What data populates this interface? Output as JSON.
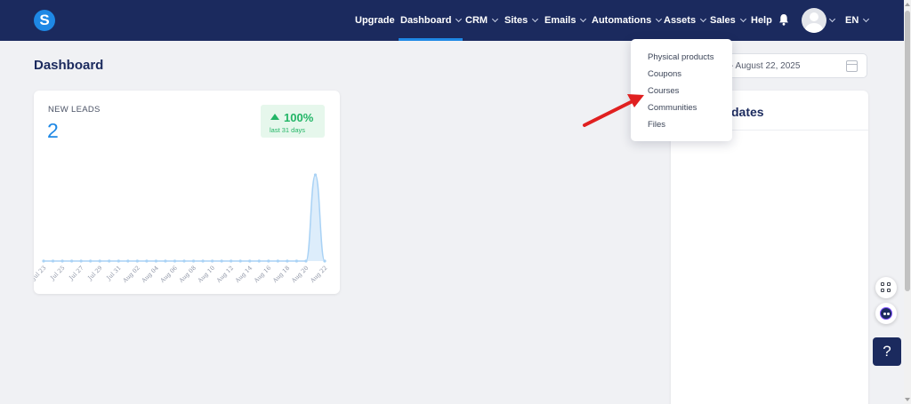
{
  "nav": {
    "logo": "S",
    "items": [
      {
        "label": "Upgrade"
      },
      {
        "label": "Dashboard"
      },
      {
        "label": "CRM"
      },
      {
        "label": "Sites"
      },
      {
        "label": "Emails"
      },
      {
        "label": "Automations"
      },
      {
        "label": "Assets"
      },
      {
        "label": "Sales"
      },
      {
        "label": "Help"
      }
    ],
    "language": "EN"
  },
  "page": {
    "title": "Dashboard",
    "date_range": "- August 22, 2025"
  },
  "leads_card": {
    "label": "NEW LEADS",
    "value": "2",
    "change": "100%",
    "change_period": "last 31 days"
  },
  "updates_panel": {
    "title": "dates"
  },
  "assets_dropdown": {
    "items": [
      {
        "label": "Physical products"
      },
      {
        "label": "Coupons"
      },
      {
        "label": "Courses"
      },
      {
        "label": "Communities"
      },
      {
        "label": "Files"
      }
    ]
  },
  "help_button": {
    "label": "?"
  },
  "colors": {
    "nav_bg": "#1b2a5e",
    "accent": "#1e88e5",
    "positive": "#22b566",
    "annotation_arrow": "#e02020"
  },
  "chart_data": {
    "type": "area",
    "title": "",
    "xlabel": "",
    "ylabel": "",
    "x": [
      "Jul 23",
      "Jul 24",
      "Jul 25",
      "Jul 26",
      "Jul 27",
      "Jul 28",
      "Jul 29",
      "Jul 30",
      "Jul 31",
      "Aug 01",
      "Aug 02",
      "Aug 03",
      "Aug 04",
      "Aug 05",
      "Aug 06",
      "Aug 07",
      "Aug 08",
      "Aug 09",
      "Aug 10",
      "Aug 11",
      "Aug 12",
      "Aug 13",
      "Aug 14",
      "Aug 15",
      "Aug 16",
      "Aug 17",
      "Aug 18",
      "Aug 19",
      "Aug 20",
      "Aug 21",
      "Aug 22"
    ],
    "tick_labels": [
      "Jul 23",
      "Jul 25",
      "Jul 27",
      "Jul 29",
      "Jul 31",
      "Aug 02",
      "Aug 04",
      "Aug 06",
      "Aug 08",
      "Aug 10",
      "Aug 12",
      "Aug 14",
      "Aug 16",
      "Aug 18",
      "Aug 20",
      "Aug 22"
    ],
    "values": [
      0,
      0,
      0,
      0,
      0,
      0,
      0,
      0,
      0,
      0,
      0,
      0,
      0,
      0,
      0,
      0,
      0,
      0,
      0,
      0,
      0,
      0,
      0,
      0,
      0,
      0,
      0,
      0,
      0,
      2,
      0
    ],
    "ylim": [
      0,
      2
    ],
    "grid": false,
    "color": "#1e88e5"
  }
}
